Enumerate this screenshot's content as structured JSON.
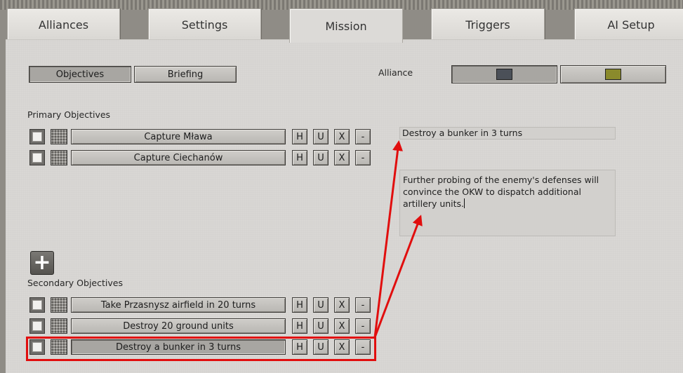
{
  "tabs": [
    "Alliances",
    "Settings",
    "Mission",
    "Triggers",
    "AI Setup"
  ],
  "subtabs": {
    "objectives": "Objectives",
    "briefing": "Briefing"
  },
  "alliance": {
    "label": "Alliance",
    "colors": [
      "#4b5058",
      "#8a8a2c"
    ]
  },
  "primary": {
    "title": "Primary Objectives",
    "items": [
      "Capture Mława",
      "Capture Ciechanów"
    ]
  },
  "secondary": {
    "title": "Secondary Objectives",
    "items": [
      "Take Przasnysz airfield in 20 turns",
      "Destroy 20 ground units",
      "Destroy a bunker in 3 turns"
    ]
  },
  "row_buttons": {
    "h": "H",
    "u": "U",
    "x": "X",
    "minus": "-"
  },
  "add_button": "+",
  "editor": {
    "title_value": "Destroy a bunker in 3 turns",
    "description": "Further probing of the enemy's defenses will convince the OKW to dispatch additional artillery units."
  }
}
